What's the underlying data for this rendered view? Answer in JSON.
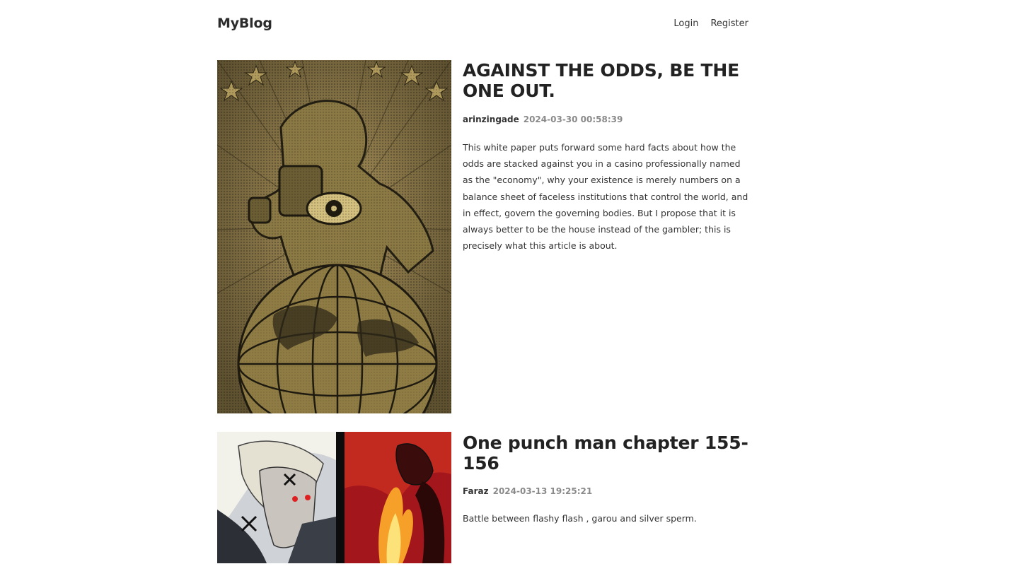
{
  "header": {
    "brand": "MyBlog",
    "nav": {
      "login": "Login",
      "register": "Register"
    }
  },
  "posts": [
    {
      "title": "AGAINST THE ODDS, BE THE ONE OUT.",
      "author": "arinzingade",
      "date": "2024-03-30 00:58:39",
      "excerpt": "This white paper puts forward some hard facts about how the odds are stacked against you in a casino professionally named as the \"economy\", why your existence is merely numbers on a balance sheet of faceless institutions that control the world, and in effect, govern the governing bodies. But I propose that it is always better to be the house instead of the gambler; this is precisely what this article is about."
    },
    {
      "title": "One punch man chapter 155-156",
      "author": "Faraz",
      "date": "2024-03-13 19:25:21",
      "excerpt": "Battle between flashy flash , garou and silver sperm."
    }
  ]
}
